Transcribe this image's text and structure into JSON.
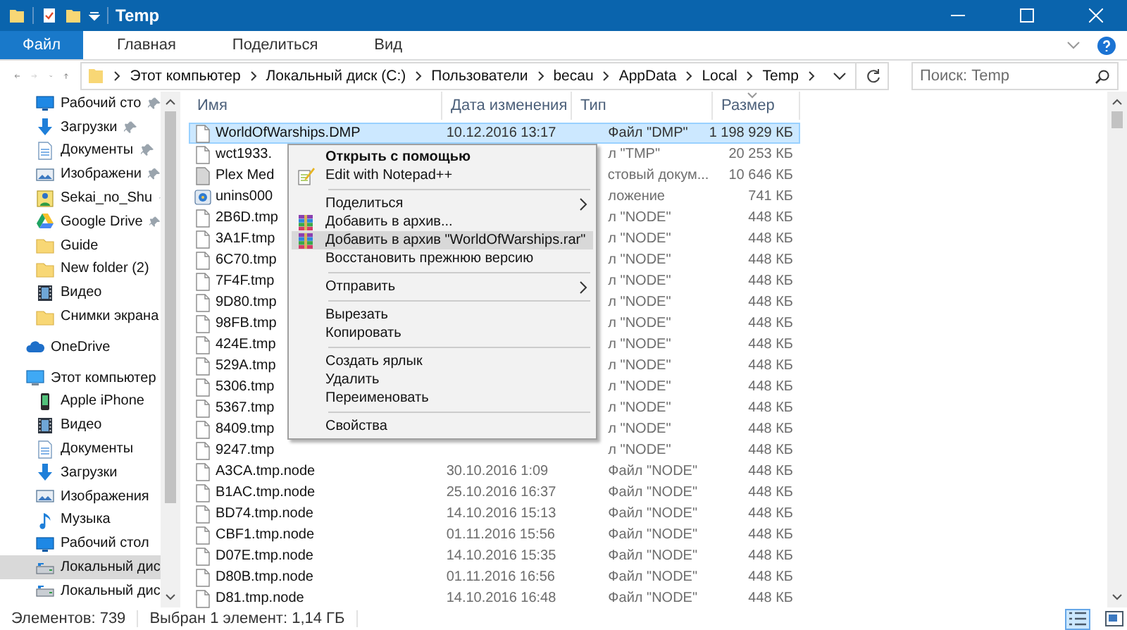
{
  "window": {
    "title": "Temp"
  },
  "ribbon_tabs": [
    {
      "label": "Файл",
      "selected": true
    },
    {
      "label": "Главная",
      "selected": false
    },
    {
      "label": "Поделиться",
      "selected": false
    },
    {
      "label": "Вид",
      "selected": false
    }
  ],
  "breadcrumb": [
    "Этот компьютер",
    "Локальный диск (C:)",
    "Пользователи",
    "becau",
    "AppData",
    "Local",
    "Temp"
  ],
  "search": {
    "placeholder": "Поиск: Temp"
  },
  "sidebar": {
    "quick_access": [
      {
        "label": "Рабочий сто",
        "kind": "desktop",
        "pinned": true,
        "selected": false
      },
      {
        "label": "Загрузки",
        "kind": "downloads",
        "pinned": true,
        "selected": false
      },
      {
        "label": "Документы",
        "kind": "documents",
        "pinned": true,
        "selected": false
      },
      {
        "label": "Изображени",
        "kind": "pictures",
        "pinned": true,
        "selected": false
      },
      {
        "label": "Sekai_no_Shu",
        "kind": "person",
        "pinned": true,
        "selected": false
      },
      {
        "label": "Google Drive",
        "kind": "drive",
        "pinned": true,
        "selected": false
      },
      {
        "label": "Guide",
        "kind": "folder",
        "pinned": false,
        "selected": false
      },
      {
        "label": "New folder (2)",
        "kind": "folder",
        "pinned": false,
        "selected": false
      },
      {
        "label": "Видео",
        "kind": "video",
        "pinned": false,
        "selected": false
      },
      {
        "label": "Снимки экрана",
        "kind": "folder",
        "pinned": false,
        "selected": false
      }
    ],
    "onedrive": {
      "label": "OneDrive",
      "kind": "cloud",
      "selected": false
    },
    "this_pc": {
      "label": "Этот компьютер",
      "kind": "pc",
      "selected": false,
      "children": [
        {
          "label": "Apple iPhone",
          "kind": "phone",
          "selected": false
        },
        {
          "label": "Видео",
          "kind": "video",
          "selected": false
        },
        {
          "label": "Документы",
          "kind": "documents",
          "selected": false
        },
        {
          "label": "Загрузки",
          "kind": "downloads",
          "selected": false
        },
        {
          "label": "Изображения",
          "kind": "pictures",
          "selected": false
        },
        {
          "label": "Музыка",
          "kind": "music",
          "selected": false
        },
        {
          "label": "Рабочий стол",
          "kind": "desktop",
          "selected": false
        },
        {
          "label": "Локальный дис",
          "kind": "disk",
          "selected": true
        },
        {
          "label": "Локальный дис",
          "kind": "disk",
          "selected": false
        }
      ]
    }
  },
  "table": {
    "columns": [
      {
        "label": "Имя",
        "sorted": false
      },
      {
        "label": "Дата изменения",
        "sorted": false
      },
      {
        "label": "Тип",
        "sorted": false
      },
      {
        "label": "Размер",
        "sorted": true
      }
    ],
    "rows": [
      {
        "name": "WorldOfWarships.DMP",
        "date": "10.12.2016 13:17",
        "type": "Файл \"DMP\"",
        "size": "1 198 929 КБ",
        "kind": "file",
        "selected": true
      },
      {
        "name": "wct1933.",
        "type": "л \"TMP\"",
        "size": "20 253 КБ",
        "kind": "file",
        "selected": false
      },
      {
        "name": "Plex Med",
        "type": "стовый докум...",
        "size": "10 646 КБ",
        "kind": "text",
        "selected": false
      },
      {
        "name": "unins000",
        "type": "ложение",
        "size": "741 КБ",
        "kind": "installer",
        "selected": false
      },
      {
        "name": "2B6D.tmp",
        "type": "л \"NODE\"",
        "size": "448 КБ",
        "kind": "file",
        "selected": false
      },
      {
        "name": "3A1F.tmp",
        "type": "л \"NODE\"",
        "size": "448 КБ",
        "kind": "file",
        "selected": false
      },
      {
        "name": "6C70.tmp",
        "type": "л \"NODE\"",
        "size": "448 КБ",
        "kind": "file",
        "selected": false
      },
      {
        "name": "7F4F.tmp",
        "type": "л \"NODE\"",
        "size": "448 КБ",
        "kind": "file",
        "selected": false
      },
      {
        "name": "9D80.tmp",
        "type": "л \"NODE\"",
        "size": "448 КБ",
        "kind": "file",
        "selected": false
      },
      {
        "name": "98FB.tmp",
        "type": "л \"NODE\"",
        "size": "448 КБ",
        "kind": "file",
        "selected": false
      },
      {
        "name": "424E.tmp",
        "type": "л \"NODE\"",
        "size": "448 КБ",
        "kind": "file",
        "selected": false
      },
      {
        "name": "529A.tmp",
        "type": "л \"NODE\"",
        "size": "448 КБ",
        "kind": "file",
        "selected": false
      },
      {
        "name": "5306.tmp",
        "type": "л \"NODE\"",
        "size": "448 КБ",
        "kind": "file",
        "selected": false
      },
      {
        "name": "5367.tmp",
        "type": "л \"NODE\"",
        "size": "448 КБ",
        "kind": "file",
        "selected": false
      },
      {
        "name": "8409.tmp",
        "type": "л \"NODE\"",
        "size": "448 КБ",
        "kind": "file",
        "selected": false
      },
      {
        "name": "9247.tmp",
        "type": "л \"NODE\"",
        "size": "448 КБ",
        "kind": "file",
        "selected": false
      },
      {
        "name": "A3CA.tmp.node",
        "date": "30.10.2016 1:09",
        "type": "Файл \"NODE\"",
        "size": "448 КБ",
        "kind": "file",
        "selected": false
      },
      {
        "name": "B1AC.tmp.node",
        "date": "25.10.2016 16:37",
        "type": "Файл \"NODE\"",
        "size": "448 КБ",
        "kind": "file",
        "selected": false
      },
      {
        "name": "BD74.tmp.node",
        "date": "14.10.2016 15:13",
        "type": "Файл \"NODE\"",
        "size": "448 КБ",
        "kind": "file",
        "selected": false
      },
      {
        "name": "CBF1.tmp.node",
        "date": "01.11.2016 15:56",
        "type": "Файл \"NODE\"",
        "size": "448 КБ",
        "kind": "file",
        "selected": false
      },
      {
        "name": "D07E.tmp.node",
        "date": "14.10.2016 15:35",
        "type": "Файл \"NODE\"",
        "size": "448 КБ",
        "kind": "file",
        "selected": false
      },
      {
        "name": "D80B.tmp.node",
        "date": "01.11.2016 16:56",
        "type": "Файл \"NODE\"",
        "size": "448 КБ",
        "kind": "file",
        "selected": false
      },
      {
        "name": "D81.tmp.node",
        "date": "14.10.2016 16:48",
        "type": "Файл \"NODE\"",
        "size": "448 КБ",
        "kind": "file",
        "selected": false
      }
    ]
  },
  "context_menu": [
    {
      "kind": "plain",
      "label": "Открыть с помощью",
      "default": true,
      "submenu": false,
      "selected": false
    },
    {
      "kind": "notepad",
      "label": "Edit with Notepad++",
      "default": false,
      "submenu": false,
      "selected": false
    },
    {
      "kind": "separator"
    },
    {
      "kind": "plain",
      "label": "Поделиться",
      "default": false,
      "submenu": true,
      "selected": false
    },
    {
      "kind": "archive",
      "label": "Добавить в архив...",
      "default": false,
      "submenu": false,
      "selected": false
    },
    {
      "kind": "archive",
      "label": "Добавить в архив \"WorldOfWarships.rar\"",
      "default": false,
      "submenu": false,
      "selected": true
    },
    {
      "kind": "plain",
      "label": "Восстановить прежнюю версию",
      "default": false,
      "submenu": false,
      "selected": false
    },
    {
      "kind": "separator"
    },
    {
      "kind": "plain",
      "label": "Отправить",
      "default": false,
      "submenu": true,
      "selected": false
    },
    {
      "kind": "separator"
    },
    {
      "kind": "plain",
      "label": "Вырезать",
      "default": false,
      "submenu": false,
      "selected": false
    },
    {
      "kind": "plain",
      "label": "Копировать",
      "default": false,
      "submenu": false,
      "selected": false
    },
    {
      "kind": "separator"
    },
    {
      "kind": "plain",
      "label": "Создать ярлык",
      "default": false,
      "submenu": false,
      "selected": false
    },
    {
      "kind": "plain",
      "label": "Удалить",
      "default": false,
      "submenu": false,
      "selected": false
    },
    {
      "kind": "plain",
      "label": "Переименовать",
      "default": false,
      "submenu": false,
      "selected": false
    },
    {
      "kind": "separator"
    },
    {
      "kind": "plain",
      "label": "Свойства",
      "default": false,
      "submenu": false,
      "selected": false
    }
  ],
  "status_bar": {
    "items_count": "Элементов: 739",
    "selection": "Выбран 1 элемент: 1,14 ГБ"
  },
  "view_buttons": [
    {
      "kind": "details",
      "selected": true
    },
    {
      "kind": "tiles",
      "selected": false
    }
  ]
}
